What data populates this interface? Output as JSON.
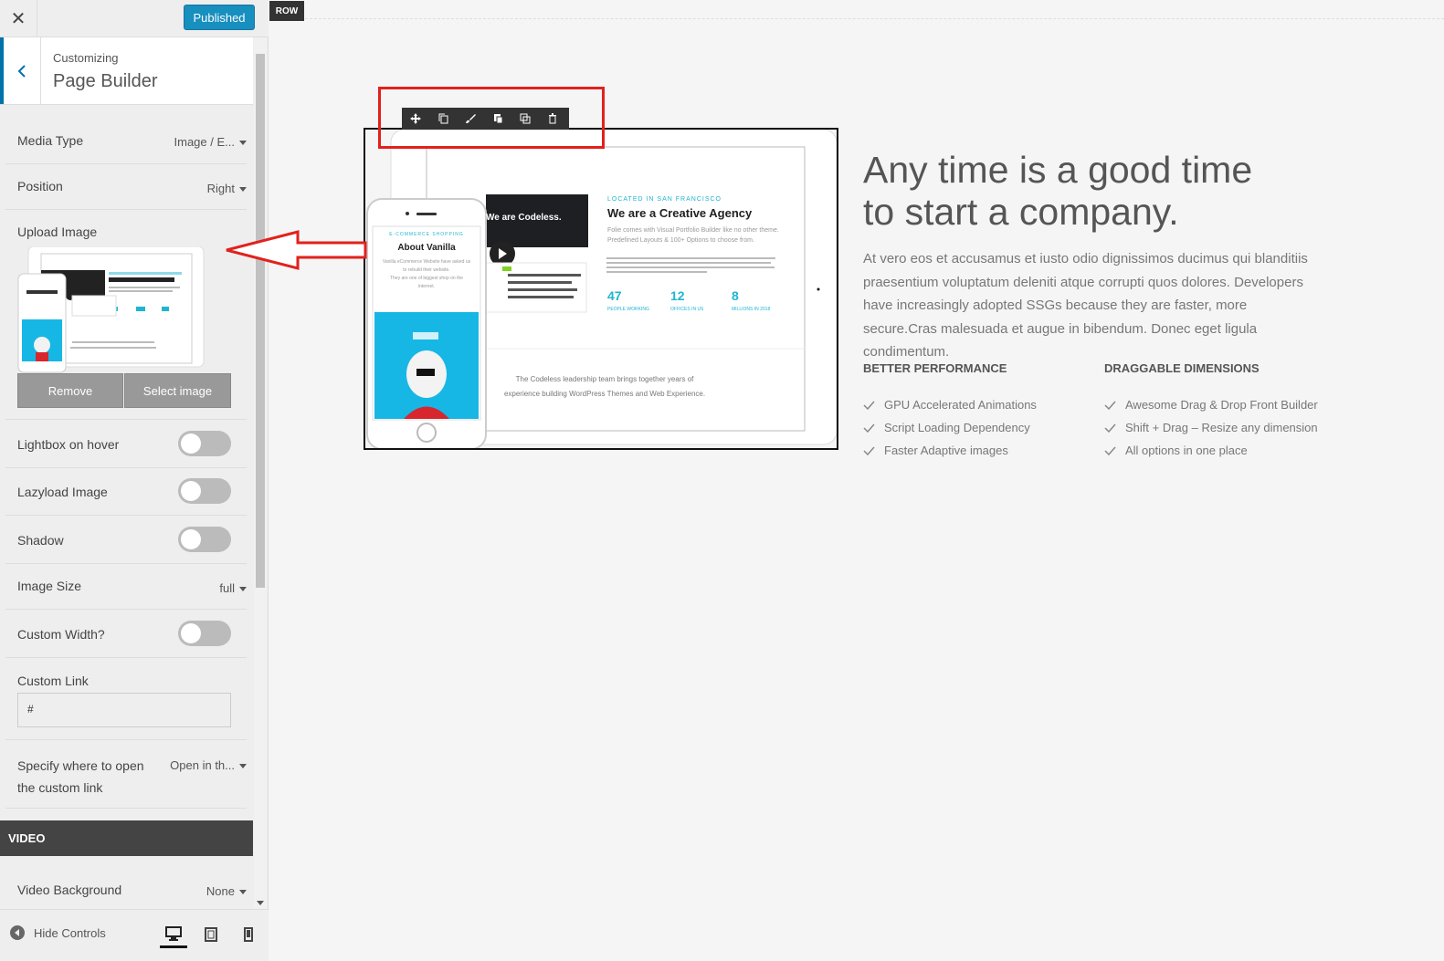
{
  "topbar": {
    "close_icon": "close-icon",
    "publish_label": "Published"
  },
  "section": {
    "customizing_label": "Customizing",
    "title": "Page Builder"
  },
  "fields": {
    "media_type": {
      "label": "Media Type",
      "value": "Image / E..."
    },
    "position": {
      "label": "Position",
      "value": "Right"
    },
    "upload_image": {
      "label": "Upload Image",
      "remove_label": "Remove",
      "select_label": "Select image"
    },
    "lightbox": {
      "label": "Lightbox on hover"
    },
    "lazyload": {
      "label": "Lazyload Image"
    },
    "shadow": {
      "label": "Shadow"
    },
    "image_size": {
      "label": "Image Size",
      "value": "full"
    },
    "custom_width": {
      "label": "Custom Width?"
    },
    "custom_link": {
      "label": "Custom Link",
      "value": "#"
    },
    "open_link": {
      "label_line1": "Specify where to open",
      "label_line2": "the custom link",
      "value": "Open in th..."
    },
    "video_header": "VIDEO",
    "video_background": {
      "label": "Video Background",
      "value": "None"
    }
  },
  "footer": {
    "hide_controls_label": "Hide Controls"
  },
  "preview": {
    "row_tag": "ROW",
    "headline_line1": "Any time is a good time",
    "headline_line2": "to start a company.",
    "body": "At vero eos et accusamus et iusto odio dignissimos ducimus qui blanditiis praesentium voluptatum deleniti atque corrupti quos dolores. Developers have increasingly adopted SSGs because they are faster, more secure.Cras malesuada et augue in bibendum. Donec eget ligula condimentum.",
    "col1": {
      "title": "BETTER PERFORMANCE",
      "items": [
        "GPU Accelerated Animations",
        "Script Loading Dependency",
        "Faster  Adaptive images"
      ]
    },
    "col2": {
      "title": "DRAGGABLE DIMENSIONS",
      "items": [
        "Awesome Drag & Drop Front Builder",
        "Shift + Drag – Resize any dimension",
        "All options in one place"
      ]
    },
    "mock": {
      "located": "LOCATED IN SAN FRANCISCO",
      "agency": "We are a Creative Agency",
      "agency_sub_line1": "Folie comes with Visual Portfolio Builder like no other theme.",
      "agency_sub_line2": "Predefined Layouts & 100+ Options to choose from.",
      "codeless": "We are Codeless.",
      "stat1": "47",
      "stat1_label": "PEOPLE WORKING",
      "stat2": "12",
      "stat2_label": "OFFICES IN US",
      "stat3": "8",
      "stat3_label": "MILLIONS IN 2018",
      "phone_tag": "E-COMMERCE SHOPPING",
      "phone_title": "About Vanilla",
      "phone_body_line1": "Vanilla eCommerce Website have asked us",
      "phone_body_line2": "to rebuild their website.",
      "phone_body_line3": "They are one of biggest shop on the",
      "phone_body_line4": "internet.",
      "leadership_line1": "The Codeless leadership team brings together years of",
      "leadership_line2": "experience building WordPress Themes and Web Experience."
    }
  },
  "colors": {
    "accent": "#0085ba",
    "red_annotation": "#e2211c",
    "stat_cyan": "#1fb5d1",
    "phone_bg": "#16b7e5"
  }
}
